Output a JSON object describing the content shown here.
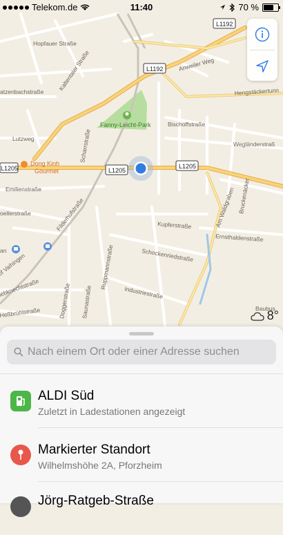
{
  "status_bar": {
    "carrier": "Telekom.de",
    "time": "11:40",
    "battery": "70 %",
    "battery_level": 0.7
  },
  "map": {
    "road_badges": [
      "L1192",
      "L1192",
      "L1205",
      "L1205",
      "L1205"
    ],
    "park_label": "Fanny-Leicht-Park",
    "poi_label_line1": "Dong Kinh",
    "poi_label_line2": "Gourmet",
    "streets": {
      "hopfauer": "Hopfauer Straße",
      "kaltentaler": "Kaltentaler Straße",
      "ratzenbach": "atzenbachstraße",
      "anweiler": "Anweiler Weg",
      "hengstaecker": "Hengstäckertunn",
      "bischoff": "Bischoffstraße",
      "weglaender": "Wegländerstraß",
      "lutzweg": "Lutzweg",
      "scharr": "Scharrstraße",
      "emilien": "Emilienstraße",
      "filderhof": "Filderhofstraße",
      "moeller": "oellerstraße",
      "vaihingen": "of Vaihingen",
      "liebknecht": "iebknechtstraße",
      "hesbruehl": "Heßbrühlstraße",
      "dogger": "Doggerstraße",
      "sauna": "Saunastraße",
      "ruppmann": "Ruppmannstraße",
      "industrie": "Industriestraße",
      "schocken": "Schockenriedstraße",
      "kupfer": "Kupferstraße",
      "ernsthalden": "Ernsthaldenstraße",
      "waldgraben": "Am Waldgraben",
      "bruckenaecker": "Bruckenäcker",
      "baubus": "Baubus",
      "man": "an"
    },
    "weather_temp": "8°"
  },
  "controls": {
    "info_icon": "info-icon",
    "location_icon": "location-arrow-icon"
  },
  "search": {
    "placeholder": "Nach einem Ort oder einer Adresse suchen"
  },
  "results": [
    {
      "title": "ALDI Süd",
      "subtitle": "Zuletzt in Ladestationen angezeigt",
      "icon": "charging-station-icon",
      "color": "#4cb648"
    },
    {
      "title": "Markierter Standort",
      "subtitle": "Wilhelmshöhe 2A, Pforzheim",
      "icon": "pin-icon",
      "color": "#e8574a"
    },
    {
      "title": "Jörg-Ratgeb-Straße",
      "subtitle": "",
      "icon": "place-icon",
      "color": "#555555"
    }
  ]
}
